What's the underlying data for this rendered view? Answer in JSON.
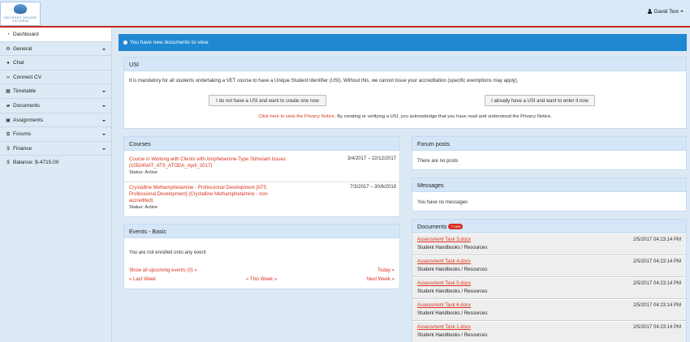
{
  "header": {
    "logo_line1": "ODYSSEY HOUSE",
    "logo_line2": "VICTORIA",
    "user_name": "David Test"
  },
  "sidebar": {
    "items": [
      {
        "label": "Dashboard",
        "icon": "gauge-icon",
        "has_caret": false
      },
      {
        "label": "General",
        "icon": "gear-icon",
        "has_caret": true
      },
      {
        "label": "Chat",
        "icon": "chat-icon",
        "has_caret": false
      },
      {
        "label": "Connect CV",
        "icon": "link-icon",
        "has_caret": false
      },
      {
        "label": "Timetable",
        "icon": "calendar-icon",
        "has_caret": true
      },
      {
        "label": "Documents",
        "icon": "folder-icon",
        "has_caret": true
      },
      {
        "label": "Assignments",
        "icon": "briefcase-icon",
        "has_caret": true
      },
      {
        "label": "Forums",
        "icon": "forum-icon",
        "has_caret": true
      },
      {
        "label": "Finance",
        "icon": "dollar-icon",
        "has_caret": true
      }
    ],
    "balance": "Balance: $-4715.00"
  },
  "alert": {
    "text": "You have new documents to view."
  },
  "usi": {
    "title": "USI",
    "description": "It is mandatory for all students undertaking a VET course to have a Unique Student Identifier (USI). Without this, we cannot issue your accreditation (specific exemptions may apply).",
    "btn_create": "I do not have a USI and want to create one now",
    "btn_enter": "I already have a USI and want to enter it now",
    "privacy_link": "Click here to view the Privacy Notice.",
    "privacy_rest": " By creating or verifying a USI, you acknowledge that you have read and understood the Privacy Notice."
  },
  "courses": {
    "title": "Courses",
    "items": [
      {
        "name": "Course in Working with Clients with Amphetamine-Type Stimulant Issues (10524NAT_ATS_ATODA_April_2017)",
        "dates": "3/4/2017 – 22/12/2017",
        "status": "Status: Active"
      },
      {
        "name": "Crystalline Methamphetamine - Professional Development [ATS Professional Development] (Crystalline Methamphetamine - non-accredited)",
        "dates": "7/3/2017 – 30/6/2019",
        "status": "Status: Active"
      }
    ]
  },
  "events": {
    "title": "Events - Basic",
    "empty": "You are not enrolled onto any event",
    "show_all": "Show all upcoming events (0) »",
    "today": "Today »",
    "last_week": "« Last Week",
    "this_week": "« This Week »",
    "next_week": "Next Week »"
  },
  "forum": {
    "title": "Forum posts",
    "empty": "There are no posts"
  },
  "messages": {
    "title": "Messages",
    "empty": "You have no messages"
  },
  "documents": {
    "title": "Documents",
    "badge": "7 new",
    "items": [
      {
        "name": "Assessment Task 3.docx",
        "category": "Student Handbooks / Resources",
        "date": "2/5/2017 04:23:14 PM"
      },
      {
        "name": "Assessment Task 4.docx",
        "category": "Student Handbooks / Resources",
        "date": "2/5/2017 04:23:14 PM"
      },
      {
        "name": "Assessment Task 5.docx",
        "category": "Student Handbooks / Resources",
        "date": "2/5/2017 04:23:14 PM"
      },
      {
        "name": "Assessment Task 6.docx",
        "category": "Student Handbooks / Resources",
        "date": "2/5/2017 04:23:14 PM"
      },
      {
        "name": "Assessment Task 1.docx",
        "category": "Student Handbooks / Resources",
        "date": "2/5/2017 04:23:14 PM"
      }
    ]
  },
  "colors": {
    "accent_blue": "#1e88d3",
    "link_red": "#d9341c",
    "panel_header": "#d4e6f7",
    "badge_red": "#d9281e"
  }
}
